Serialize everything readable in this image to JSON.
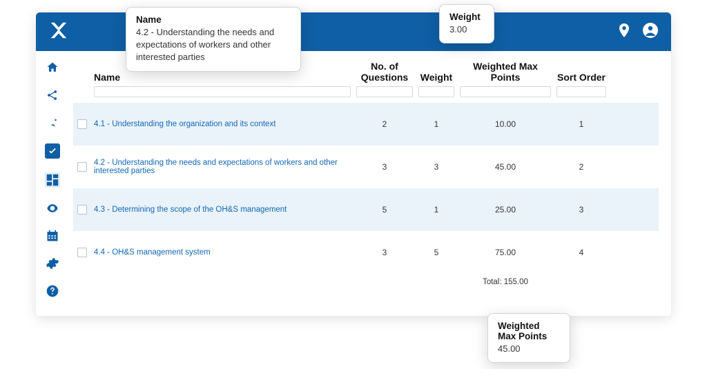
{
  "topbar": {},
  "sidenav": {},
  "columns": {
    "name": "Name",
    "questions": "No. of Questions",
    "weight": "Weight",
    "wmp": "Weighted Max Points",
    "sort": "Sort Order"
  },
  "rows": [
    {
      "name": "4.1 - Understanding the organization and its context",
      "questions": "2",
      "weight": "1",
      "wmp": "10.00",
      "sort": "1"
    },
    {
      "name": "4.2 - Understanding the needs and expectations of workers and other interested parties",
      "questions": "3",
      "weight": "3",
      "wmp": "45.00",
      "sort": "2"
    },
    {
      "name": "4.3 - Determining the scope of the OH&S management",
      "questions": "5",
      "weight": "1",
      "wmp": "25.00",
      "sort": "3"
    },
    {
      "name": "4.4 - OH&S management system",
      "questions": "3",
      "weight": "5",
      "wmp": "75.00",
      "sort": "4"
    }
  ],
  "total": {
    "label": "Total: 155.00"
  },
  "tooltip_name": {
    "title": "Name",
    "body": "4.2 - Understanding the needs and expectations of workers and other interested parties"
  },
  "tooltip_weight": {
    "title": "Weight",
    "body": "3.00"
  },
  "tooltip_wmp": {
    "title": "Weighted Max Points",
    "body": "45.00"
  }
}
